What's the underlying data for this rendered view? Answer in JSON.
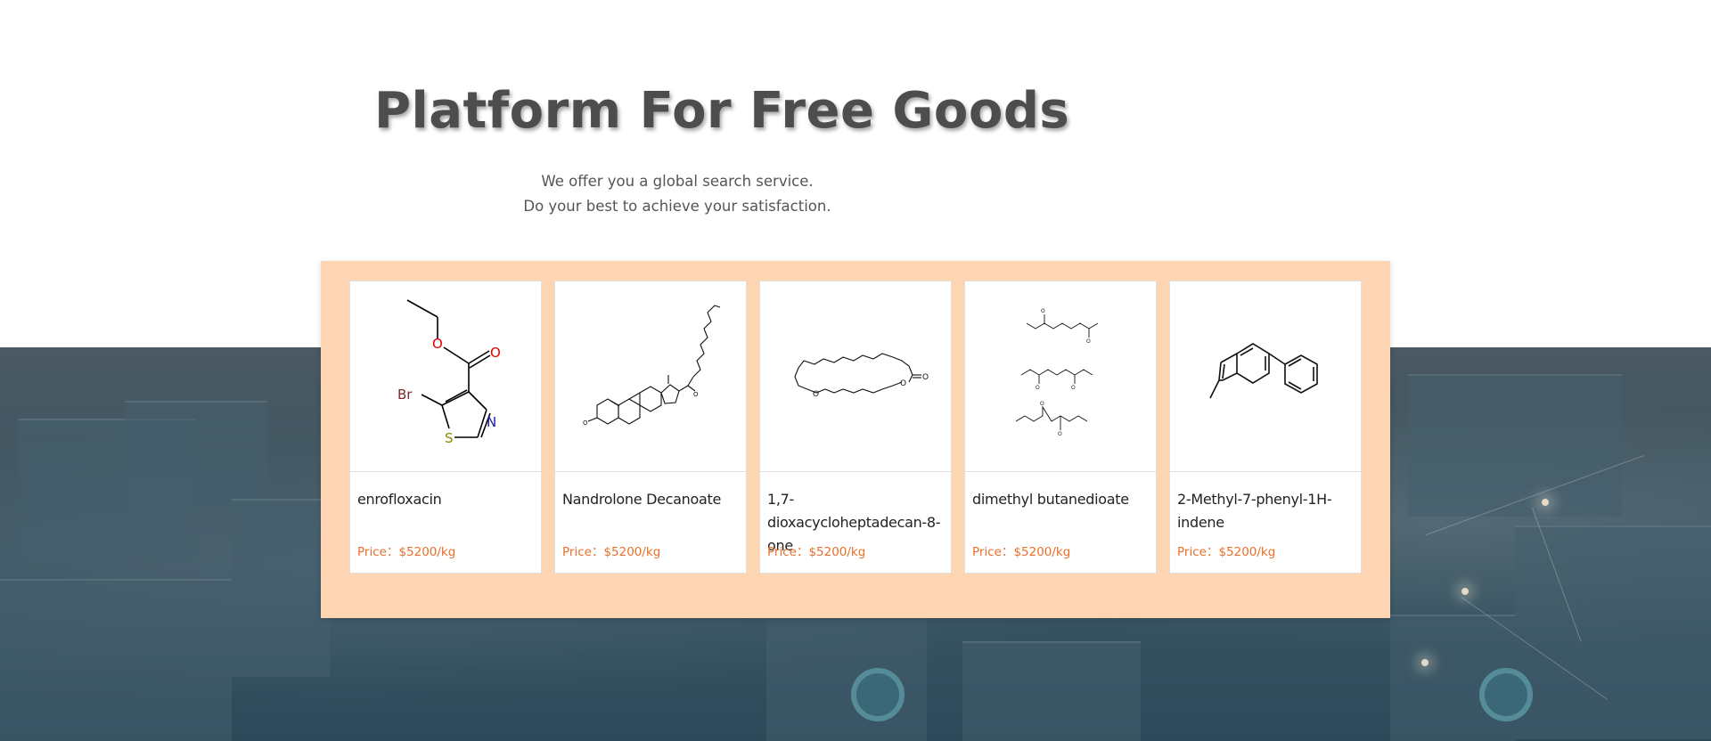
{
  "hero": {
    "title": "Platform For Free Goods",
    "subtitle_line1": "We offer you a global search service.",
    "subtitle_line2": "Do your best to achieve your satisfaction."
  },
  "products": [
    {
      "name": "enrofloxacin",
      "price_label": "Price：",
      "price_value": "$5200/kg",
      "structure_icon": "molecule-enrofloxacin"
    },
    {
      "name": "Nandrolone Decanoate",
      "price_label": "Price：",
      "price_value": "$5200/kg",
      "structure_icon": "molecule-nandrolone-decanoate"
    },
    {
      "name": "1,7-dioxacycloheptadecan-8-one",
      "price_label": "Price：",
      "price_value": "$5200/kg",
      "structure_icon": "molecule-dioxacycloheptadecanone"
    },
    {
      "name": "dimethyl butanedioate",
      "price_label": "Price：",
      "price_value": "$5200/kg",
      "structure_icon": "molecule-dimethyl-butanedioate"
    },
    {
      "name": "2-Methyl-7-phenyl-1H-indene",
      "price_label": "Price：",
      "price_value": "$5200/kg",
      "structure_icon": "molecule-methyl-phenyl-indene"
    }
  ],
  "molecule_labels": {
    "br": "Br",
    "s": "S",
    "n": "N",
    "o": "O"
  },
  "colors": {
    "panel_bg": "#fdd5b3",
    "price": "#e8702a",
    "title": "#4d4d4d",
    "hero_bg": "#3e5561"
  }
}
